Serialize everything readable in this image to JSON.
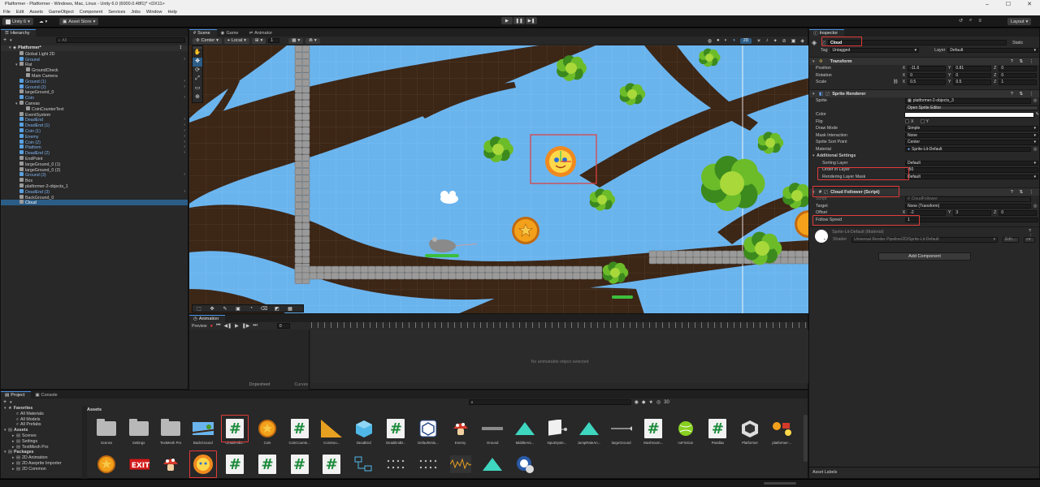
{
  "window": {
    "title": "Platformer - Platformer - Windows, Mac, Linux - Unity 6.0 (6000.0.48f1)* <DX11>"
  },
  "menu": [
    "File",
    "Edit",
    "Assets",
    "GameObject",
    "Component",
    "Services",
    "Jobs",
    "Window",
    "Help"
  ],
  "toolbar": {
    "account": "Unity 6",
    "asset_store": "Asset Store",
    "layout": "Layout"
  },
  "hierarchy": {
    "tab": "Hierarchy",
    "search_placeholder": "All",
    "root": "Platformer*",
    "items": [
      {
        "label": "Global Light 2D",
        "depth": 1,
        "prefab": false
      },
      {
        "label": "Ground",
        "depth": 1,
        "prefab": true
      },
      {
        "label": "Rat",
        "depth": 1,
        "prefab": false
      },
      {
        "label": "GroundCheck",
        "depth": 2,
        "prefab": false
      },
      {
        "label": "Main Camera",
        "depth": 2,
        "prefab": false
      },
      {
        "label": "Ground (1)",
        "depth": 1,
        "prefab": true
      },
      {
        "label": "Ground (2)",
        "depth": 1,
        "prefab": true
      },
      {
        "label": "largeGround_0",
        "depth": 1,
        "prefab": false
      },
      {
        "label": "Coin",
        "depth": 1,
        "prefab": true
      },
      {
        "label": "Canvas",
        "depth": 1,
        "prefab": false
      },
      {
        "label": "CoinCounterText",
        "depth": 2,
        "prefab": false
      },
      {
        "label": "EventSystem",
        "depth": 1,
        "prefab": false
      },
      {
        "label": "DeadEnd",
        "depth": 1,
        "prefab": true
      },
      {
        "label": "DeadEnd (1)",
        "depth": 1,
        "prefab": true
      },
      {
        "label": "Coin (1)",
        "depth": 1,
        "prefab": true
      },
      {
        "label": "Enemy",
        "depth": 1,
        "prefab": true
      },
      {
        "label": "Coin (2)",
        "depth": 1,
        "prefab": true
      },
      {
        "label": "Platform",
        "depth": 1,
        "prefab": true
      },
      {
        "label": "DeadEnd (2)",
        "depth": 1,
        "prefab": true
      },
      {
        "label": "EndPoint",
        "depth": 1,
        "prefab": false
      },
      {
        "label": "largeGround_0 (1)",
        "depth": 1,
        "prefab": false
      },
      {
        "label": "largeGround_0 (2)",
        "depth": 1,
        "prefab": false
      },
      {
        "label": "Ground (3)",
        "depth": 1,
        "prefab": true
      },
      {
        "label": "Box",
        "depth": 1,
        "prefab": false
      },
      {
        "label": "platformer-2-objects_1",
        "depth": 1,
        "prefab": false
      },
      {
        "label": "DeadEnd (3)",
        "depth": 1,
        "prefab": true
      },
      {
        "label": "BackGround_0",
        "depth": 1,
        "prefab": false
      },
      {
        "label": "Cloud",
        "depth": 1,
        "prefab": false,
        "selected": true
      }
    ]
  },
  "scene": {
    "tabs": [
      "Scene",
      "Game",
      "Animator"
    ],
    "pivot": "Center",
    "space": "Local",
    "grid_snap": "1",
    "mode_2d": "2D"
  },
  "animation": {
    "tab": "Animation",
    "preview": "Preview",
    "frame": "0",
    "empty_msg": "No animatable object selected",
    "dopesheet": "Dopesheet",
    "curves": "Curves"
  },
  "inspector": {
    "tab": "Inspector",
    "name": "Cloud",
    "static": "Static",
    "tag_label": "Tag",
    "tag": "Untagged",
    "layer_label": "Layer",
    "layer": "Default",
    "transform": {
      "title": "Transform",
      "position": {
        "label": "Position",
        "x": "-11.6",
        "y": "0.81",
        "z": "0"
      },
      "rotation": {
        "label": "Rotation",
        "x": "0",
        "y": "0",
        "z": "0"
      },
      "scale": {
        "label": "Scale",
        "x": "0.5",
        "y": "0.5",
        "z": "1"
      }
    },
    "sprite_renderer": {
      "title": "Sprite Renderer",
      "sprite_label": "Sprite",
      "sprite": "platformer-2-objects_3",
      "open_editor": "Open Sprite Editor",
      "color_label": "Color",
      "flip_label": "Flip",
      "flip_x": "X",
      "flip_y": "Y",
      "draw_mode_label": "Draw Mode",
      "draw_mode": "Simple",
      "mask_label": "Mask Interaction",
      "mask": "None",
      "sort_point_label": "Sprite Sort Point",
      "sort_point": "Center",
      "material_label": "Material",
      "material": "Sprite-Lit-Default",
      "additional": "Additional Settings",
      "sorting_layer_label": "Sorting Layer",
      "sorting_layer": "Default",
      "order_label": "Order in Layer",
      "order": "-50",
      "rendering_mask_label": "Rendering Layer Mask",
      "rendering_mask": "Default"
    },
    "cloud_follower": {
      "title": "Cloud Follower (Script)",
      "script_label": "Script",
      "script": "CloudFollower",
      "target_label": "Target",
      "target": "None (Transform)",
      "offset_label": "Offset",
      "x": "-2",
      "y": "3",
      "z": "0",
      "speed_label": "Follow Speed",
      "speed": "1"
    },
    "material_block": {
      "name": "Sprite-Lit-Default (Material)",
      "shader_label": "Shader",
      "shader": "Universal Render Pipeline/2D/Sprite-Lit-Default",
      "edit": "Edit..."
    },
    "add_component": "Add Component",
    "asset_labels": "Asset Labels"
  },
  "project": {
    "tabs": [
      "Project",
      "Console"
    ],
    "count": "30",
    "tree": [
      {
        "label": "Favorites",
        "depth": 0,
        "bold": true
      },
      {
        "label": "All Materials",
        "depth": 1
      },
      {
        "label": "All Models",
        "depth": 1
      },
      {
        "label": "All Prefabs",
        "depth": 1
      },
      {
        "label": "Assets",
        "depth": 0,
        "bold": true
      },
      {
        "label": "Scenes",
        "depth": 1
      },
      {
        "label": "Settings",
        "depth": 1
      },
      {
        "label": "TextMesh Pro",
        "depth": 1
      },
      {
        "label": "Packages",
        "depth": 0,
        "bold": true
      },
      {
        "label": "2D Animation",
        "depth": 1
      },
      {
        "label": "2D Aseprite Importer",
        "depth": 1
      },
      {
        "label": "2D Common",
        "depth": 1
      }
    ],
    "breadcrumb": "Assets",
    "assets_row1": [
      {
        "label": "Scenes",
        "kind": "folder"
      },
      {
        "label": "Settings",
        "kind": "folder"
      },
      {
        "label": "TextMesh Pro",
        "kind": "folder"
      },
      {
        "label": "BackGround",
        "kind": "bg"
      },
      {
        "label": "CloudFollo...",
        "kind": "hash",
        "hl": true
      },
      {
        "label": "Coin",
        "kind": "coin"
      },
      {
        "label": "CoinCounte...",
        "kind": "hash"
      },
      {
        "label": "CoinSou...",
        "kind": "audio"
      },
      {
        "label": "DeadEnd",
        "kind": "cube"
      },
      {
        "label": "DeadEndD...",
        "kind": "hash"
      },
      {
        "label": "DefaultVolu...",
        "kind": "vol"
      },
      {
        "label": "Enemy",
        "kind": "mush"
      },
      {
        "label": "Ground",
        "kind": "ground"
      },
      {
        "label": "MiddleAni...",
        "kind": "tri"
      },
      {
        "label": "InputSyste...",
        "kind": "input"
      },
      {
        "label": "JumpRateAn...",
        "kind": "tri"
      },
      {
        "label": "largeGround",
        "kind": "line"
      },
      {
        "label": "Mushroom...",
        "kind": "hash"
      },
      {
        "label": "noFriction",
        "kind": "ball"
      },
      {
        "label": "Parallax",
        "kind": "hash"
      },
      {
        "label": "Platformer",
        "kind": "unity"
      },
      {
        "label": "platformer-...",
        "kind": "sheet"
      }
    ],
    "assets_row2": [
      {
        "label": "",
        "kind": "coin"
      },
      {
        "label": "",
        "kind": "exit"
      },
      {
        "label": "",
        "kind": "mush"
      },
      {
        "label": "",
        "kind": "flower",
        "hl": true
      },
      {
        "label": "",
        "kind": "hash"
      },
      {
        "label": "",
        "kind": "hash"
      },
      {
        "label": "",
        "kind": "hash"
      },
      {
        "label": "",
        "kind": "hash"
      },
      {
        "label": "",
        "kind": "graph"
      },
      {
        "label": "",
        "kind": "dots"
      },
      {
        "label": "",
        "kind": "dots"
      },
      {
        "label": "",
        "kind": "wave"
      },
      {
        "label": "",
        "kind": "tri"
      },
      {
        "label": "",
        "kind": "gear"
      }
    ]
  },
  "colors": {
    "accent": "#4a90e2",
    "prefab": "#7fb2ee",
    "selection": "#2c5d87",
    "highlight": "#e23b3b",
    "sky": "#6ab4ee"
  }
}
